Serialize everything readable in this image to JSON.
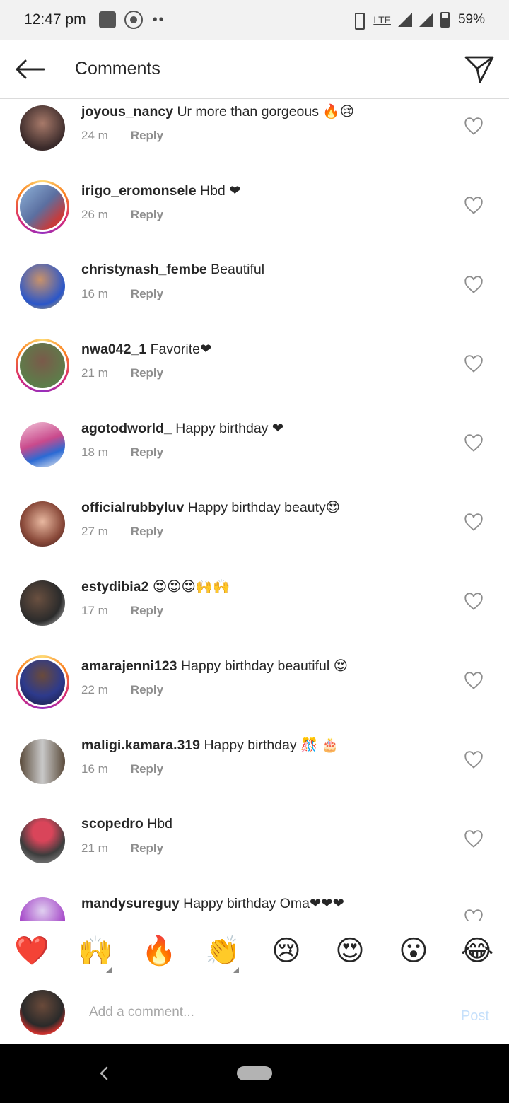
{
  "status_bar": {
    "time": "12:47 pm",
    "network": "LTE",
    "battery": "59%"
  },
  "header": {
    "title": "Comments"
  },
  "comments": [
    {
      "username": "joyous_nancy",
      "text": "Ur more than gorgeous 🔥😢",
      "time": "24 m",
      "reply": "Reply",
      "story_ring": false,
      "avatar_color": "#3a2a2a"
    },
    {
      "username": "irigo_eromonsele",
      "text": "Hbd ❤",
      "time": "26 m",
      "reply": "Reply",
      "story_ring": true,
      "avatar_color": "#6b7fa3"
    },
    {
      "username": "christynash_fembe",
      "text": "Beautiful",
      "time": "16 m",
      "reply": "Reply",
      "story_ring": false,
      "avatar_color": "#2a56c9"
    },
    {
      "username": "nwa042_1",
      "text": "Favorite❤",
      "time": "21 m",
      "reply": "Reply",
      "story_ring": true,
      "avatar_color": "#5d7d4a"
    },
    {
      "username": "agotodworld_",
      "text": "Happy birthday ❤",
      "time": "18 m",
      "reply": "Reply",
      "story_ring": false,
      "avatar_color": "#c94a8c"
    },
    {
      "username": "officialrubbyluv",
      "text": "Happy birthday beauty😍",
      "time": "27 m",
      "reply": "Reply",
      "story_ring": false,
      "avatar_color": "#8a4a3a"
    },
    {
      "username": "estydibia2",
      "text": "😍😍😍🙌🙌",
      "time": "17 m",
      "reply": "Reply",
      "story_ring": false,
      "avatar_color": "#2b2b2b"
    },
    {
      "username": "amarajenni123",
      "text": "Happy birthday beautiful 😍",
      "time": "22 m",
      "reply": "Reply",
      "story_ring": true,
      "avatar_color": "#2d3a8c"
    },
    {
      "username": "maligi.kamara.319",
      "text": "Happy birthday 🎊 🎂",
      "time": "16 m",
      "reply": "Reply",
      "story_ring": false,
      "avatar_color": "#5a4a3a"
    },
    {
      "username": "scopedro",
      "text": "Hbd",
      "time": "21 m",
      "reply": "Reply",
      "story_ring": false,
      "avatar_color": "#3d3d3d"
    },
    {
      "username": "mandysureguy",
      "text": "Happy birthday Oma❤❤❤",
      "time": "",
      "reply": "",
      "story_ring": false,
      "avatar_color": "#a64ac9"
    }
  ],
  "emoji_bar": [
    {
      "char": "❤️",
      "icon": "red-heart"
    },
    {
      "char": "🙌",
      "icon": "raising-hands",
      "tone_picker": true
    },
    {
      "char": "🔥",
      "icon": "fire"
    },
    {
      "char": "👏",
      "icon": "clapping-hands",
      "tone_picker": true
    },
    {
      "char": "😢",
      "icon": "crying-face"
    },
    {
      "char": "😍",
      "icon": "heart-eyes"
    },
    {
      "char": "😮",
      "icon": "surprised-face"
    },
    {
      "char": "😂",
      "icon": "tears-of-joy"
    }
  ],
  "composer": {
    "placeholder": "Add a comment...",
    "post_label": "Post"
  },
  "colors": {
    "text": "#262626",
    "secondary_text": "#8e8e8e",
    "post_disabled": "#c6e0fb",
    "divider": "#dbdbdb"
  }
}
